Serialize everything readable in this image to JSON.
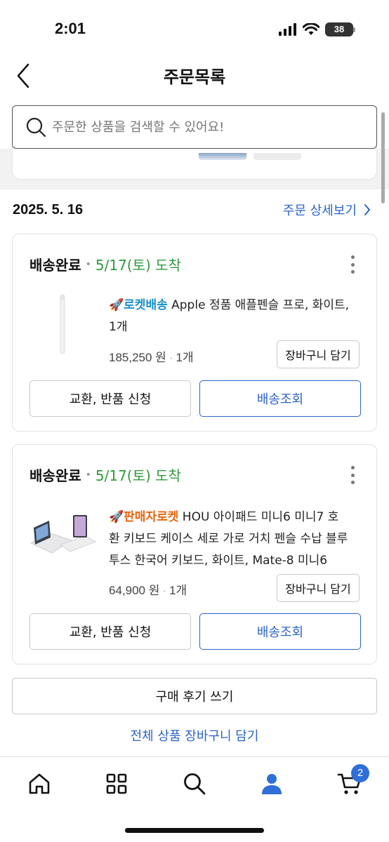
{
  "status_bar": {
    "time": "2:01",
    "battery": "38",
    "icons": [
      "signal-icon",
      "wifi-icon",
      "battery-icon"
    ]
  },
  "header": {
    "title": "주문목록",
    "back_icon": "chevron-left-icon"
  },
  "search": {
    "placeholder": "주문한 상품을 검색할 수 있어요!",
    "value": ""
  },
  "order": {
    "date": "2025. 5. 16",
    "detail_link": "주문 상세보기",
    "items": [
      {
        "status": "배송완료",
        "arrival": "5/17(토) 도착",
        "badge": "로켓배송",
        "name": "Apple 정품 애플펜슬 프로, 화이트,",
        "name_line2": "1개",
        "price": "185,250 원",
        "quantity": "1개",
        "cart_button": "장바구니 담기",
        "exchange_button": "교환, 반품 신청",
        "track_button": "배송조회"
      },
      {
        "status": "배송완료",
        "arrival": "5/17(토) 도착",
        "badge": "판매자로켓",
        "name": "HOU 아이패드 미니6 미니7 호",
        "name_line2": "환 키보드 케이스 세로 가로 거치 펜슬 수납 블루",
        "name_line3": "투스 한국어 키보드, 화이트, Mate-8 미니6",
        "price": "64,900 원",
        "quantity": "1개",
        "cart_button": "장바구니 담기",
        "exchange_button": "교환, 반품 신청",
        "track_button": "배송조회"
      }
    ],
    "review_button": "구매 후기 쓰기",
    "add_all_link": "전체 상품 장바구니 담기"
  },
  "bottom_nav": {
    "items": [
      "home-icon",
      "category-grid-icon",
      "search-icon",
      "my-account-icon",
      "cart-icon"
    ],
    "cart_count": "2"
  },
  "colors": {
    "accent": "#2b63c7",
    "delivered": "#2f9a3c",
    "rocket": "#1a8fc9",
    "seller_rocket": "#e8640b"
  }
}
